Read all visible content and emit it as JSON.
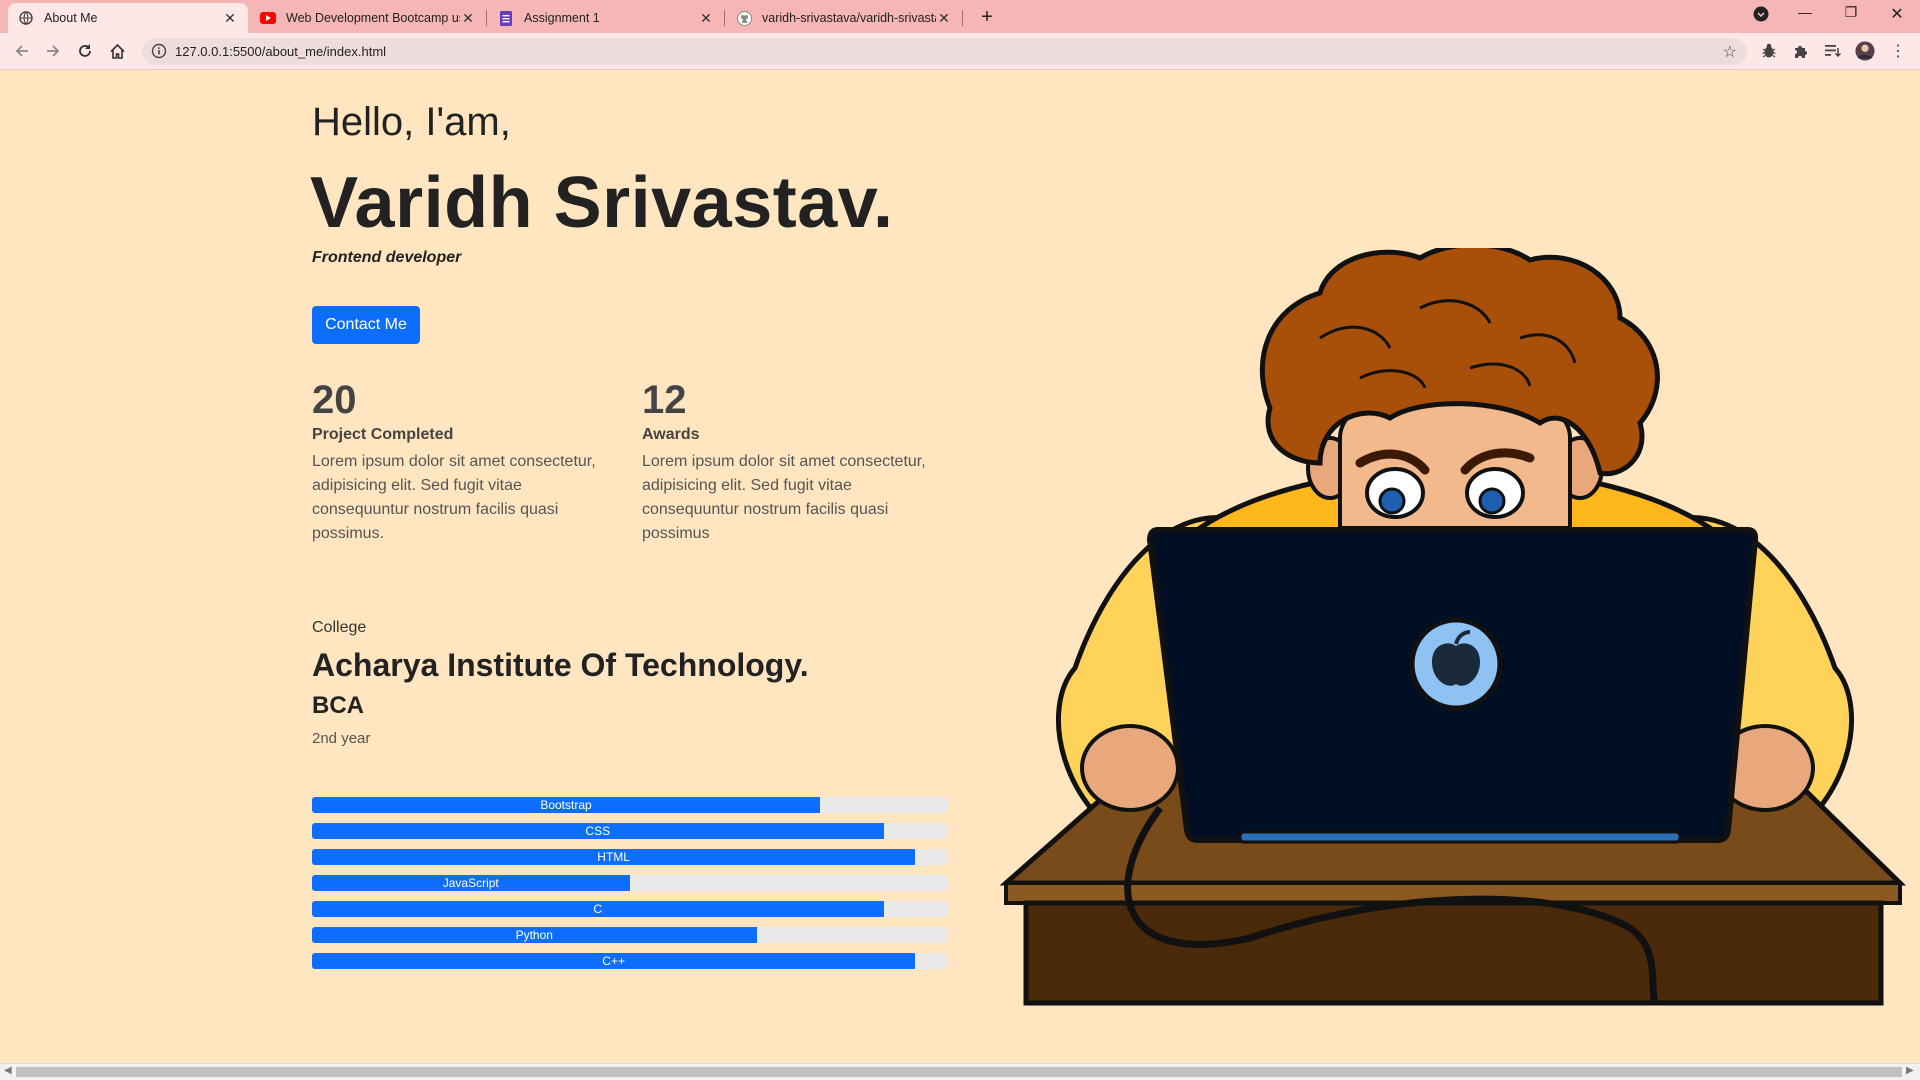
{
  "browser": {
    "tabs": [
      {
        "title": "About Me",
        "icon": "globe-icon"
      },
      {
        "title": "Web Development Bootcamp using",
        "icon": "youtube-icon"
      },
      {
        "title": "Assignment 1",
        "icon": "forms-icon"
      },
      {
        "title": "varidh-srivastava/varidh-srivastava",
        "icon": "github-icon"
      }
    ],
    "url": "127.0.0.1:5500/about_me/index.html"
  },
  "hero": {
    "greeting": "Hello, I'am,",
    "name": "Varidh Srivastav.",
    "role": "Frontend developer",
    "contact_label": "Contact Me"
  },
  "stats": [
    {
      "number": "20",
      "label": "Project Completed",
      "desc": "Lorem ipsum dolor sit amet consectetur, adipisicing elit. Sed fugit vitae consequuntur nostrum facilis quasi possimus."
    },
    {
      "number": "12",
      "label": "Awards",
      "desc": "Lorem ipsum dolor sit amet consectetur, adipisicing elit. Sed fugit vitae consequuntur nostrum facilis quasi possimus"
    }
  ],
  "education": {
    "label": "College",
    "college": "Acharya Institute Of Technology.",
    "degree": "BCA",
    "year": "2nd year"
  },
  "skills": [
    {
      "name": "Bootstrap",
      "percent": 80
    },
    {
      "name": "CSS",
      "percent": 90
    },
    {
      "name": "HTML",
      "percent": 95
    },
    {
      "name": "JavaScript",
      "percent": 50
    },
    {
      "name": "C",
      "percent": 90
    },
    {
      "name": "Python",
      "percent": 70
    },
    {
      "name": "C++",
      "percent": 95
    }
  ],
  "colors": {
    "page_bg": "#ffe5c0",
    "accent": "#0d6efd",
    "tabstrip": "#f6b6b6"
  }
}
